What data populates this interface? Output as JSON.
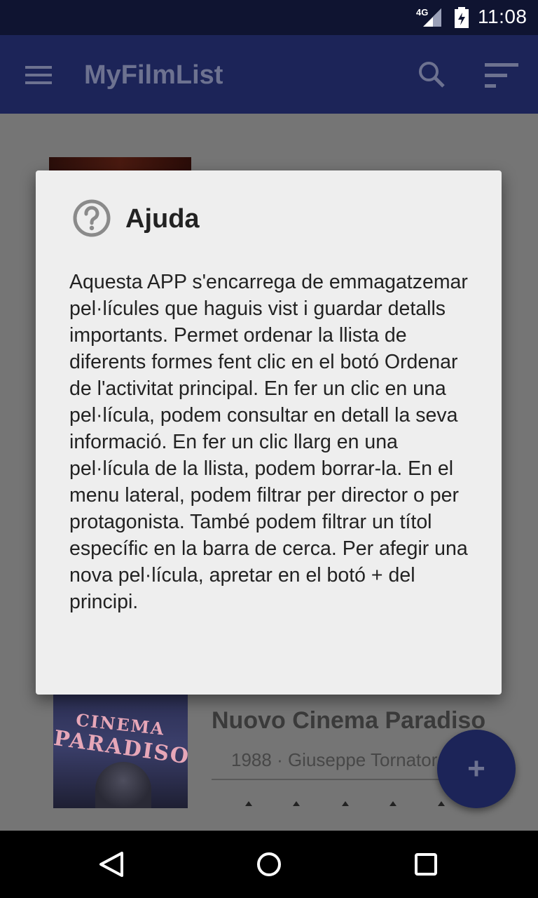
{
  "status_bar": {
    "network_label": "4G",
    "time": "11:08",
    "icons": [
      "signal-icon",
      "battery-icon"
    ]
  },
  "app_bar": {
    "title": "MyFilmList",
    "menu_icon": "hamburger-menu-icon",
    "search_icon": "search-icon",
    "sort_icon": "sort-icon"
  },
  "dialog": {
    "icon": "help-icon",
    "title": "Ajuda",
    "body": "Aquesta APP s'encarrega de emmagatzemar pel·lícules que haguis vist i guardar detalls importants. Permet ordenar la llista de diferents formes fent clic en el botó Ordenar de l'activitat principal. En fer un clic en una pel·lícula, podem consultar en detall la seva informació. En fer un clic llarg en una pel·lícula de la llista, podem borrar-la. En el menu lateral, podem filtrar per director o per protagonista. També podem filtrar un títol específic en la barra de cerca. Per afegir una nova pel·lícula, apretar en el botó + del principi."
  },
  "film_list": {
    "items": [
      {
        "title": "Nuovo Cinema Paradiso",
        "meta": "1988 · Giuseppe Tornatore",
        "poster_text": [
          "CINEMA",
          "PARADISO"
        ]
      }
    ]
  },
  "fab": {
    "label": "+"
  },
  "colors": {
    "status_bar": "#0f1431",
    "app_bar": "#1c2458",
    "scrim_content": "#757575",
    "dialog_bg": "#eeeeee",
    "fab": "#1c2458"
  },
  "nav_bar": {
    "icons": [
      "back-icon",
      "home-icon",
      "recents-icon"
    ]
  }
}
